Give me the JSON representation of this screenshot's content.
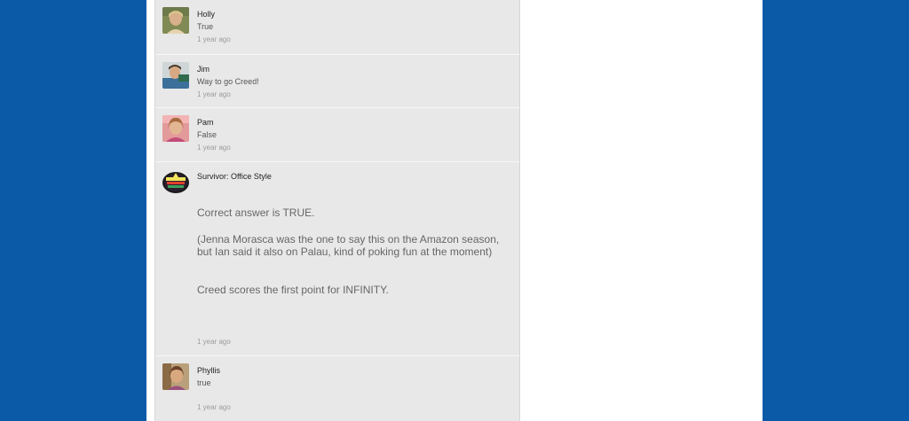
{
  "comments": [
    {
      "author": "Holly",
      "text": "True",
      "time": "1 year ago",
      "avatar_icon": "holly-avatar-icon"
    },
    {
      "author": "Jim",
      "text": "Way to go Creed!",
      "time": "1 year ago",
      "avatar_icon": "jim-avatar-icon"
    },
    {
      "author": "Pam",
      "text": "False",
      "time": "1 year ago",
      "avatar_icon": "pam-avatar-icon"
    },
    {
      "author": "Survivor: Office Style",
      "avatar_icon": "survivor-logo-avatar-icon",
      "para1": "Correct answer is TRUE.",
      "para2_line1": "(Jenna Morasca was the one to say this on the Amazon season,",
      "para2_line2": "but Ian said it also on Palau, kind of poking fun at the moment)",
      "para3": "Creed scores the first point for INFINITY.",
      "time": "1 year ago"
    },
    {
      "author": "Phyllis",
      "text": "true",
      "time": "1 year ago",
      "avatar_icon": "phyllis-avatar-icon"
    }
  ],
  "colors": {
    "background": "#0a5aa8",
    "panel": "#e8e8e8",
    "timestamp": "#9b9b9b"
  }
}
